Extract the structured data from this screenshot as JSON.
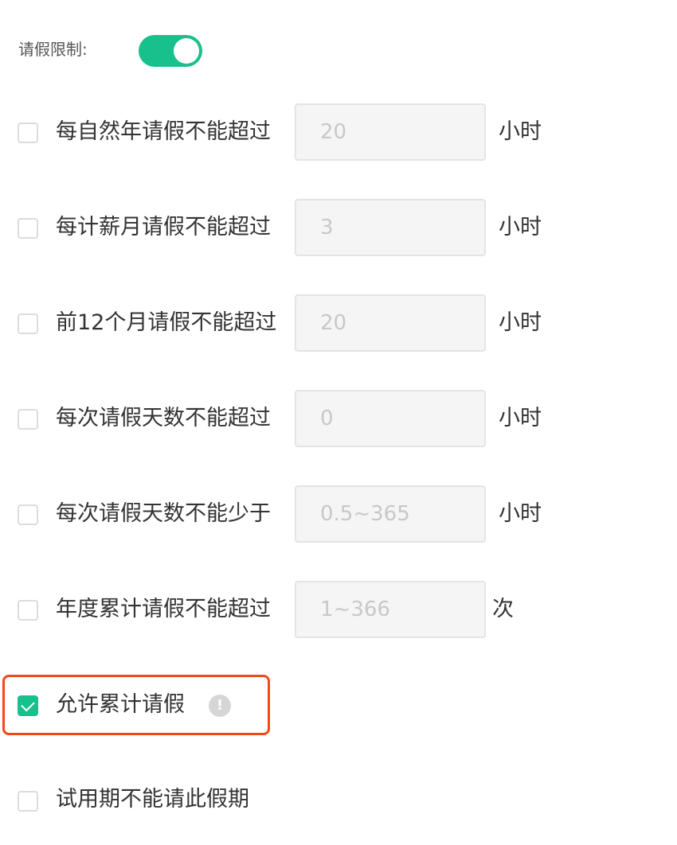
{
  "header": {
    "title": "请假限制:",
    "toggle_on": true,
    "accent_color": "#18c08b"
  },
  "rows": [
    {
      "label": "每自然年请假不能超过",
      "checked": false,
      "value": "",
      "placeholder": "20",
      "unit": "小时"
    },
    {
      "label": "每计薪月请假不能超过",
      "checked": false,
      "value": "",
      "placeholder": "3",
      "unit": "小时"
    },
    {
      "label": "前12个月请假不能超过",
      "checked": false,
      "value": "",
      "placeholder": "20",
      "unit": "小时"
    },
    {
      "label": "每次请假天数不能超过",
      "checked": false,
      "value": "",
      "placeholder": "0",
      "unit": "小时"
    },
    {
      "label": "每次请假天数不能少于",
      "checked": false,
      "value": "",
      "placeholder": "0.5~365",
      "unit": "小时"
    },
    {
      "label": "年度累计请假不能超过",
      "checked": false,
      "value": "",
      "placeholder": "1~366",
      "unit": "次"
    }
  ],
  "cumulative": {
    "label": "允许累计请假",
    "checked": true,
    "info_icon": "exclamation-circle-icon",
    "info_glyph": "!"
  },
  "probation": {
    "label": "试用期不能请此假期",
    "checked": false
  },
  "highlight_color": "#f04a1c"
}
